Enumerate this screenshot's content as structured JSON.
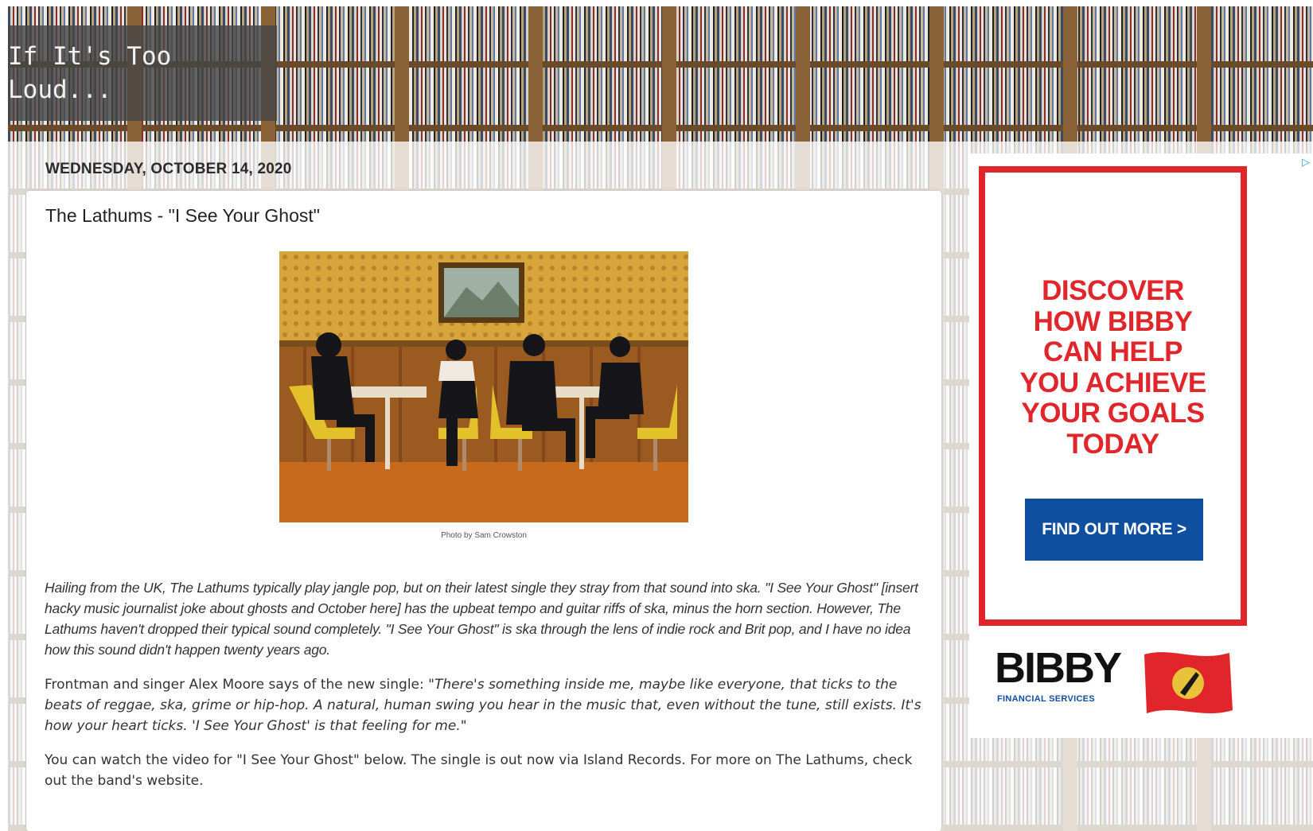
{
  "blog": {
    "title": "If It's Too Loud..."
  },
  "post": {
    "date": "WEDNESDAY, OCTOBER 14, 2020",
    "title": "The Lathums - \"I See Your Ghost\"",
    "photo_credit": "Photo by Sam Crowston",
    "p1_text": "Hailing from the UK, The Lathums typically play jangle pop, but on their latest single they stray from that sound into ska. \"I See Your Ghost\" [insert hacky music journalist joke about ghosts and October here] has the upbeat tempo and guitar riffs of ska, minus the horn section. However, The Lathums haven't dropped their typical sound completely. \"I See Your Ghost\" is ska through the lens of indie rock and Brit pop, and I have no idea how this sound didn't happen twenty years ago.",
    "p2_intro": "Frontman and singer Alex Moore says of the new single: ",
    "p2_quote": "\"There's something inside me, maybe like everyone, that ticks to the beats of reggae, ska, grime or hip-hop. A natural, human swing you hear in the music that, even without the tune, still exists. It's how your heart ticks. 'I See Your Ghost' is that feeling for me.\"",
    "p3_text": "You can watch the video for \"I See Your Ghost\" below. The single is out now via Island Records. For more on The Lathums, check out the band's ",
    "p3_link": "website",
    "p3_end": "."
  },
  "ad": {
    "headline_1": "DISCOVER",
    "headline_2": "HOW BIBBY",
    "headline_3": "CAN HELP",
    "headline_you": "YOU",
    "headline_4": " ACHIEVE",
    "headline_5": "YOUR GOALS",
    "headline_6": "TODAY",
    "cta_label": "FIND OUT MORE >",
    "logo_text": "BIBBY",
    "logo_sub": "FINANCIAL SERVICES",
    "choices_icon": "adchoices-icon",
    "colors": {
      "red": "#e0252b",
      "blue": "#0f4fa0"
    }
  }
}
